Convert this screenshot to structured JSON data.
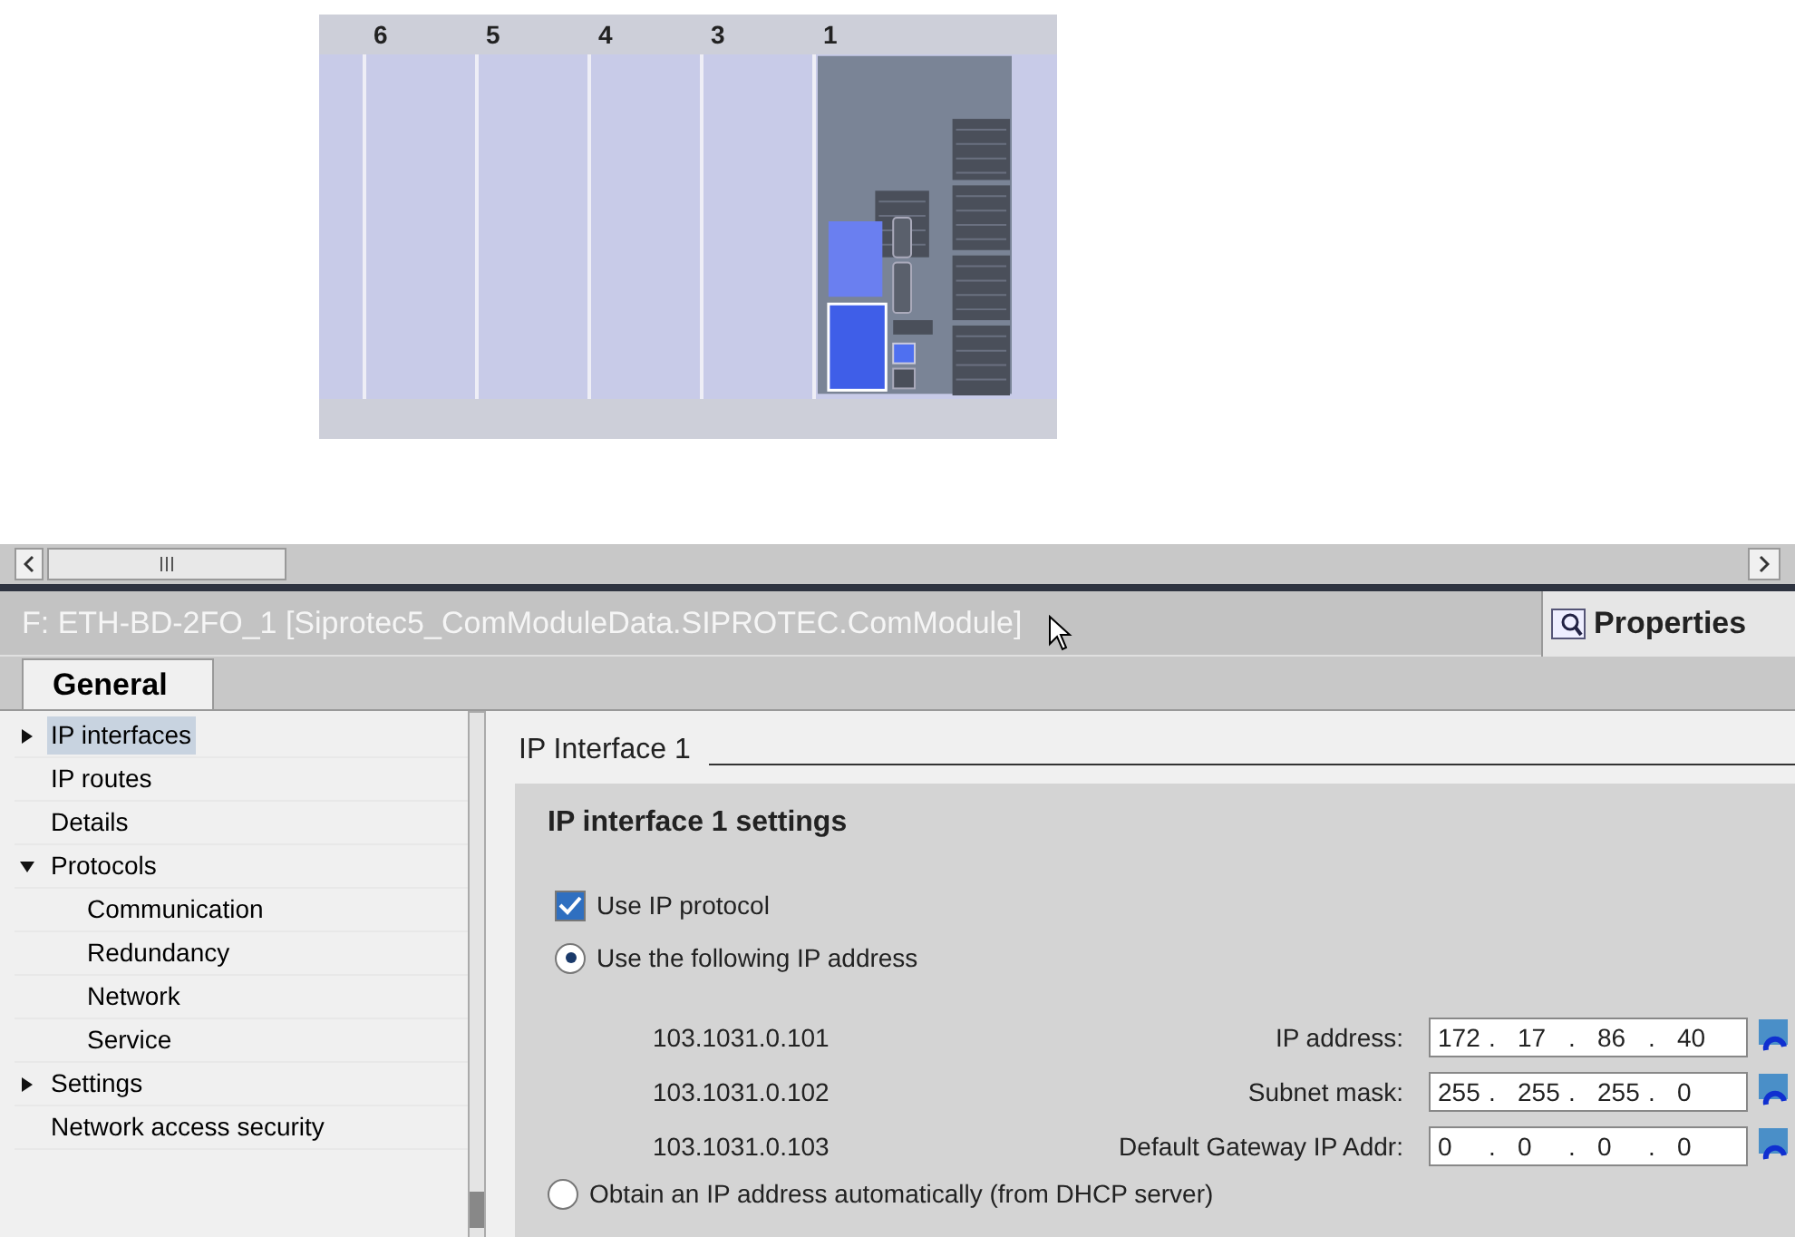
{
  "rack": {
    "slots": [
      {
        "label": "6",
        "kind": "empty"
      },
      {
        "label": "5",
        "kind": "empty"
      },
      {
        "label": "4",
        "kind": "empty"
      },
      {
        "label": "3",
        "kind": "empty"
      },
      {
        "label": "1",
        "kind": "device"
      }
    ]
  },
  "title_bar": {
    "title": "F: ETH-BD-2FO_1 [Siprotec5_ComModuleData.SIPROTEC.ComModule]",
    "properties_tab": "Properties"
  },
  "tabs": [
    {
      "label": "General",
      "selected": true
    }
  ],
  "nav": [
    {
      "label": "IP interfaces",
      "expanded": false,
      "selected": true
    },
    {
      "label": "IP routes",
      "selected": false
    },
    {
      "label": "Details",
      "selected": false
    },
    {
      "label": "Protocols",
      "expanded": true,
      "selected": false,
      "children": [
        {
          "label": "Communication",
          "selected": false
        },
        {
          "label": "Redundancy",
          "selected": false
        },
        {
          "label": "Network",
          "selected": false
        },
        {
          "label": "Service",
          "selected": false
        }
      ]
    },
    {
      "label": "Settings",
      "expanded": false,
      "selected": false
    },
    {
      "label": "Network access security",
      "selected": false
    }
  ],
  "section": {
    "title": "IP Interface 1",
    "group_title": "IP interface 1 settings",
    "use_ip_protocol": {
      "label": "Use IP protocol",
      "checked": true
    },
    "static_option": {
      "label": "Use the following IP address",
      "selected": true
    },
    "separator": ".",
    "addresses": [
      {
        "parameter": "103.1031.0.101",
        "label": "IP address:",
        "octets": [
          "172",
          "17",
          "86",
          "40"
        ]
      },
      {
        "parameter": "103.1031.0.102",
        "label": "Subnet mask:",
        "octets": [
          "255",
          "255",
          "255",
          "0"
        ]
      },
      {
        "parameter": "103.1031.0.103",
        "label": "Default Gateway IP Addr:",
        "octets": [
          "0",
          "0",
          "0",
          "0"
        ]
      }
    ],
    "dhcp_option": {
      "label": "Obtain an IP address automatically (from DHCP server)",
      "selected": false
    }
  }
}
